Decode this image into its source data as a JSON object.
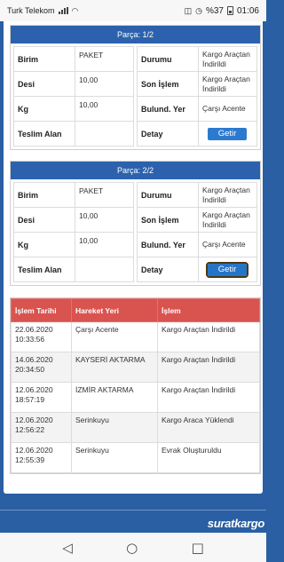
{
  "status_bar": {
    "carrier": "Turk Telekom",
    "battery": "%37",
    "time": "01:06"
  },
  "labels": {
    "unit": "Birim",
    "desi": "Desi",
    "kg": "Kg",
    "receiver": "Teslim Alan",
    "status": "Durumu",
    "last_action": "Son İşlem",
    "location": "Bulund. Yer",
    "detail": "Detay",
    "fetch_button": "Getir"
  },
  "parcels": [
    {
      "header": "Parça: 1/2",
      "unit": "PAKET",
      "desi": "10,00",
      "kg": "10,00",
      "receiver": "",
      "status": "Kargo Araçtan İndirildi",
      "last_action": "Kargo Araçtan İndirildi",
      "location": "Çarşı Acente"
    },
    {
      "header": "Parça: 2/2",
      "unit": "PAKET",
      "desi": "10,00",
      "kg": "10,00",
      "receiver": "",
      "status": "Kargo Araçtan İndirildi",
      "last_action": "Kargo Araçtan İndirildi",
      "location": "Çarşı Acente"
    }
  ],
  "history": {
    "headers": [
      "İşlem Tarihi",
      "Hareket Yeri",
      "İşlem"
    ],
    "rows": [
      {
        "date": "22.06.2020",
        "time": "10:33:56",
        "place": "Çarşı Acente",
        "action": "Kargo Araçtan İndirildi"
      },
      {
        "date": "14.06.2020",
        "time": "20:34:50",
        "place": "KAYSERİ AKTARMA",
        "action": "Kargo Araçtan İndirildi"
      },
      {
        "date": "12.06.2020",
        "time": "18:57:19",
        "place": "İZMİR AKTARMA",
        "action": "Kargo Araçtan İndirildi"
      },
      {
        "date": "12.06.2020",
        "time": "12:56:22",
        "place": "Serinkuyu",
        "action": "Kargo Araca Yüklendi"
      },
      {
        "date": "12.06.2020",
        "time": "12:55:39",
        "place": "Serinkuyu",
        "action": "Evrak Oluşturuldu"
      }
    ]
  },
  "footer": {
    "brand": "suratkargo"
  },
  "nav": {
    "back": "◁",
    "home": "○",
    "recents": "□"
  }
}
